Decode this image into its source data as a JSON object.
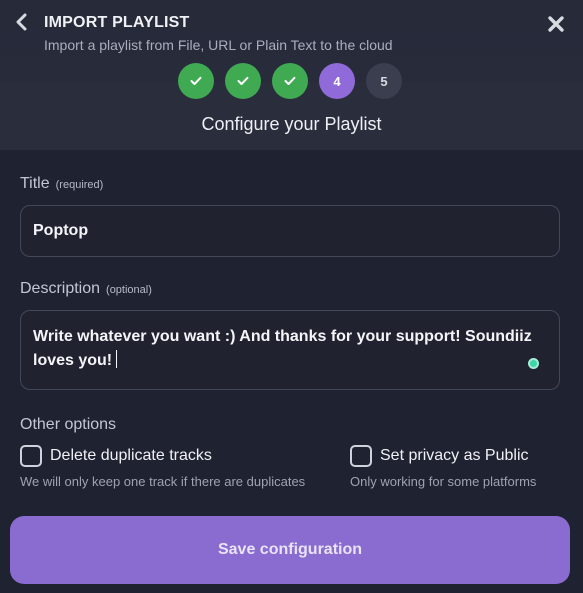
{
  "header": {
    "title": "IMPORT PLAYLIST",
    "subtitle": "Import a playlist from File, URL or Plain Text to the cloud",
    "back_icon": "chevron-left-icon",
    "close_icon": "close-icon"
  },
  "stepper": {
    "steps": [
      {
        "state": "done",
        "icon": "check-icon",
        "label": ""
      },
      {
        "state": "done",
        "icon": "check-icon",
        "label": ""
      },
      {
        "state": "done",
        "icon": "check-icon",
        "label": ""
      },
      {
        "state": "current",
        "label": "4"
      },
      {
        "state": "todo",
        "label": "5"
      }
    ],
    "current_step": 4,
    "total_steps": 5,
    "heading": "Configure your Playlist"
  },
  "form": {
    "title_label": "Title",
    "title_hint": "(required)",
    "title_value": "Poptop",
    "description_label": "Description",
    "description_hint": "(optional)",
    "description_value": "Write whatever you want :) And thanks for your support! Soundiiz loves you!",
    "other_options_label": "Other options",
    "options": [
      {
        "label": "Delete duplicate tracks",
        "description": "We will only keep one track if there are duplicates",
        "checked": false
      },
      {
        "label": "Set privacy as Public",
        "description": "Only working for some platforms",
        "checked": false
      }
    ],
    "save_label": "Save configuration"
  },
  "colors": {
    "background": "#1f2230",
    "done_step": "#3faa52",
    "current_step": "#8f6ad8",
    "primary_button": "#8a6bd0"
  }
}
